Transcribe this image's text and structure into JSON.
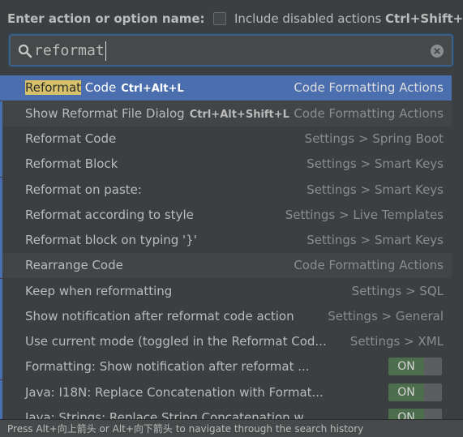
{
  "header": {
    "prompt": "Enter action or option name:",
    "checkbox_label": "Include disabled actions",
    "checkbox_shortcut": "Ctrl+Shift+A",
    "checkbox_checked": false
  },
  "search": {
    "value": "reformat",
    "icon": "search-icon",
    "clear_icon": "clear-icon"
  },
  "results": [
    {
      "highlight": "Reformat",
      "rest": " Code",
      "shortcut": "Ctrl+Alt+L",
      "location": "Code Formatting Actions",
      "selected": true
    },
    {
      "label": "Show Reformat File Dialog",
      "shortcut": "Ctrl+Alt+Shift+L",
      "location": "Code Formatting Actions"
    },
    {
      "label": "Reformat Code",
      "location": "Settings > Spring Boot"
    },
    {
      "label": "Reformat Block",
      "location": "Settings > Smart Keys"
    },
    {
      "label": "Reformat on paste:",
      "location": "Settings > Smart Keys"
    },
    {
      "label": "Reformat according to style",
      "location": "Settings > Live Templates"
    },
    {
      "label": "Reformat block on typing '}'",
      "location": "Settings > Smart Keys"
    },
    {
      "label": "Rearrange Code",
      "location": "Code Formatting Actions"
    },
    {
      "label": "Keep when reformatting",
      "location": "Settings > SQL"
    },
    {
      "label": "Show notification after reformat code action",
      "location": "Settings > General"
    },
    {
      "label": "Use current mode (toggled in the Reformat Cod...",
      "location": "Settings > XML"
    },
    {
      "label": "Formatting: Show notification after reformat ...",
      "toggle": "ON"
    },
    {
      "label": "Java: I18N: Replace Concatenation with Format...",
      "toggle": "ON"
    },
    {
      "label": "Java: Strings: Replace String Concatenation w...",
      "toggle": "ON"
    }
  ],
  "footer": {
    "hint": "Press Alt+向上箭头 or Alt+向下箭头 to navigate through the search history"
  },
  "colors": {
    "background": "#3c3f41",
    "selection": "#4b6eaf",
    "match_highlight": "#d7c16a",
    "toggle_on": "#4c6e4d"
  }
}
